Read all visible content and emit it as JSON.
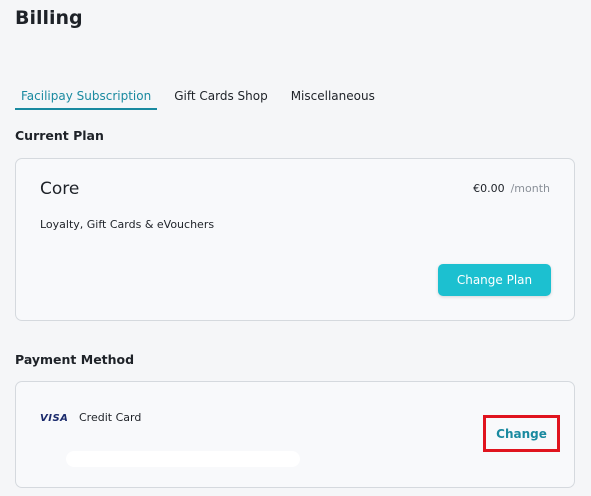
{
  "page": {
    "title": "Billing"
  },
  "tabs": [
    {
      "label": "Facilipay Subscription",
      "active": true
    },
    {
      "label": "Gift Cards Shop",
      "active": false
    },
    {
      "label": "Miscellaneous",
      "active": false
    }
  ],
  "current_plan": {
    "section_title": "Current Plan",
    "name": "Core",
    "price": "€0.00",
    "period": "/month",
    "features": "Loyalty, Gift Cards & eVouchers",
    "change_button": "Change Plan"
  },
  "payment_method": {
    "section_title": "Payment Method",
    "card_brand": "VISA",
    "card_type": "Credit Card",
    "change_link": "Change"
  },
  "colors": {
    "accent": "#1a8aa0",
    "button": "#1cc0d0",
    "highlight": "#e0141e",
    "background": "#f5f6f8"
  }
}
